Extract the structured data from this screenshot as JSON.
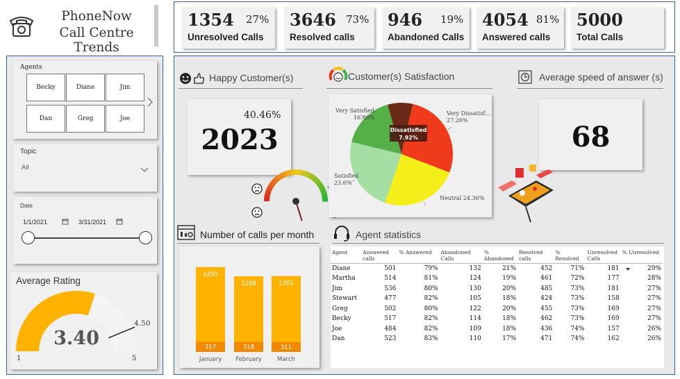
{
  "header": {
    "brand": "PhoneNow",
    "title": "Call Centre Trends"
  },
  "kpis": [
    {
      "value": "1354",
      "pct": "27%",
      "label": "Unresolved Calls"
    },
    {
      "value": "3646",
      "pct": "73%",
      "label": "Resolved calls"
    },
    {
      "value": "946",
      "pct": "19%",
      "label": "Abandoned Calls"
    },
    {
      "value": "4054",
      "pct": "81%",
      "label": "Answered calls"
    },
    {
      "value": "5000",
      "pct": "",
      "label": "Total Calls"
    }
  ],
  "filters": {
    "agents_label": "Agents",
    "agents": [
      "Becky",
      "Diane",
      "Jim",
      "Dan",
      "Greg",
      "Joe"
    ],
    "topic_label": "Topic",
    "topic_value": "All",
    "date_label": "Date",
    "date_start": "1/1/2021",
    "date_end": "3/31/2021"
  },
  "rating": {
    "title": "Average Rating",
    "value": "3.40",
    "target": "4.50",
    "min": "1",
    "max": "5",
    "fill_fraction": 0.6,
    "target_fraction": 0.875
  },
  "happy": {
    "title": "Happy Customer(s)",
    "pct": "40.46%",
    "value": "2023",
    "gauge_fraction": 0.4046
  },
  "satisfaction": {
    "title": "Customer(s) Satisfaction",
    "highlight": "Dissatisfied",
    "highlight_value": "7.92%"
  },
  "speed": {
    "title": "Average speed of answer (s)",
    "value": "68"
  },
  "calls_month": {
    "title": "Number of calls per month"
  },
  "agent_stats": {
    "title": "Agent statistics",
    "columns": [
      "Agent",
      "Answered calls",
      "% Answered",
      "Abandoned Calls",
      "% Abandoned",
      "Resolved calls",
      "% Resolved",
      "Unresolved Calls",
      "% Unresolved"
    ],
    "rows": [
      [
        "Diane",
        "501",
        "79%",
        "132",
        "21%",
        "452",
        "71%",
        "181",
        "29%"
      ],
      [
        "Martha",
        "514",
        "81%",
        "124",
        "19%",
        "461",
        "72%",
        "177",
        "28%"
      ],
      [
        "Jim",
        "536",
        "80%",
        "130",
        "20%",
        "485",
        "73%",
        "181",
        "27%"
      ],
      [
        "Stewart",
        "477",
        "82%",
        "105",
        "18%",
        "424",
        "73%",
        "158",
        "27%"
      ],
      [
        "Greg",
        "502",
        "80%",
        "122",
        "20%",
        "455",
        "73%",
        "169",
        "27%"
      ],
      [
        "Becky",
        "517",
        "82%",
        "114",
        "18%",
        "462",
        "73%",
        "169",
        "27%"
      ],
      [
        "Joe",
        "484",
        "82%",
        "109",
        "18%",
        "436",
        "74%",
        "157",
        "26%"
      ],
      [
        "Dan",
        "523",
        "83%",
        "110",
        "17%",
        "471",
        "74%",
        "162",
        "26%"
      ]
    ]
  },
  "chart_data": [
    {
      "type": "pie",
      "categories": [
        "Dissatisfied",
        "Very Dissatisfied",
        "Neutral",
        "Satisfied",
        "Very Satisfied"
      ],
      "labels": [
        "Dissatisfied",
        "Very Dissatisfied",
        "Neutral",
        "Satisfied",
        "Very Satisfied"
      ],
      "display_labels": [
        "Dissatisfied",
        "Very Dissatisf...",
        "Neutral",
        "Satisfied",
        "Very Satisfied"
      ],
      "values": [
        7.92,
        27.26,
        24.36,
        23.6,
        16.86
      ],
      "value_labels": [
        "7.92%",
        "27.26%",
        "24.36%",
        "23.6%",
        "16.86%"
      ],
      "colors": [
        "#6b2a18",
        "#f03a1c",
        "#f5ee1b",
        "#a6dfa4",
        "#55b04a"
      ]
    },
    {
      "type": "bar",
      "categories": [
        "January",
        "February",
        "March"
      ],
      "series": [
        {
          "values": [
            1455,
            1298,
            1301
          ],
          "color": "#ffb300"
        },
        {
          "values": [
            317,
            318,
            311
          ],
          "color": "#ef8a00"
        }
      ],
      "ylim": [
        0,
        1500
      ]
    }
  ],
  "colors": {
    "accent_orange": "#ffb300",
    "border_blue": "#3b5f8f",
    "gauge_track": "#f4f4f4"
  }
}
